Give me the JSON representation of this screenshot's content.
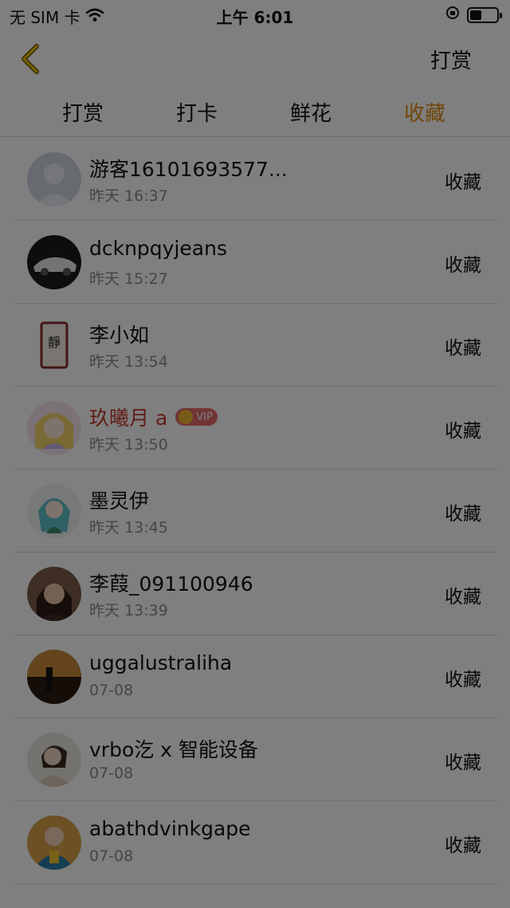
{
  "status_bar": {
    "carrier": "无 SIM 卡",
    "time": "上午 6:01"
  },
  "nav": {
    "action_label": "打赏"
  },
  "tabs": [
    {
      "label": "打赏",
      "active": false
    },
    {
      "label": "打卡",
      "active": false
    },
    {
      "label": "鲜花",
      "active": false
    },
    {
      "label": "收藏",
      "active": true
    }
  ],
  "active_tab_color": "#e58a12",
  "list": [
    {
      "name": "游客16101693577...",
      "time": "昨天 16:37",
      "action": "收藏",
      "avatar": "default-avatar"
    },
    {
      "name": "dcknpqyjeans",
      "time": "昨天 15:27",
      "action": "收藏",
      "avatar": "car-avatar"
    },
    {
      "name": "李小如",
      "time": "昨天 13:54",
      "action": "收藏",
      "avatar": "calligraphy-avatar"
    },
    {
      "name": "玖曦月 a",
      "time": "昨天 13:50",
      "action": "收藏",
      "avatar": "anime-avatar",
      "vip": true,
      "vip_label": "VIP"
    },
    {
      "name": "墨灵伊",
      "time": "昨天 13:45",
      "action": "收藏",
      "avatar": "anime-avatar-2"
    },
    {
      "name": "李葭_091100946",
      "time": "昨天 13:39",
      "action": "收藏",
      "avatar": "portrait-avatar"
    },
    {
      "name": "uggalustraliha",
      "time": "07-08",
      "action": "收藏",
      "avatar": "night-photo-avatar"
    },
    {
      "name": "vrbo汔 x 智能设备",
      "time": "07-08",
      "action": "收藏",
      "avatar": "portrait-avatar-2"
    },
    {
      "name": "abathdvinkgape",
      "time": "07-08",
      "action": "收藏",
      "avatar": "child-photo-avatar"
    }
  ]
}
